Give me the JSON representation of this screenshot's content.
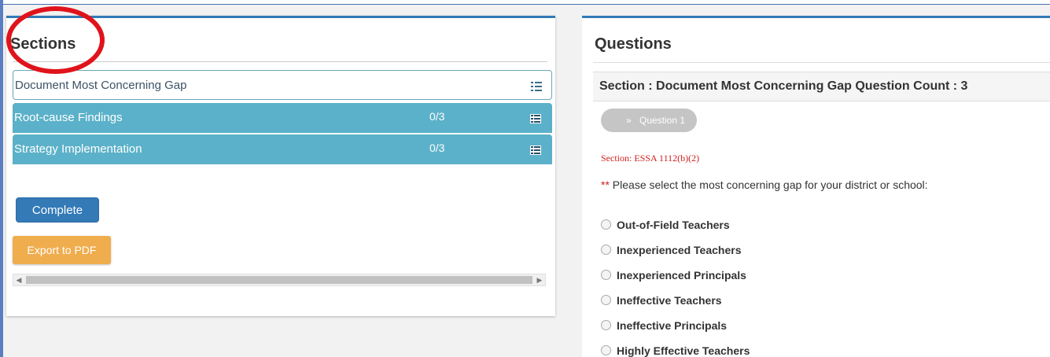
{
  "sections_panel": {
    "title": "Sections",
    "items": [
      {
        "label": "Document Most Concerning Gap",
        "count": "",
        "state": "active"
      },
      {
        "label": "Root-cause Findings",
        "count": "0/3",
        "state": "pending"
      },
      {
        "label": "Strategy Implementation",
        "count": "0/3",
        "state": "pending"
      }
    ],
    "complete_label": "Complete",
    "export_label": "Export to PDF"
  },
  "questions_panel": {
    "title": "Questions",
    "section_header": "Section : Document Most Concerning Gap Question Count : 3",
    "question_tab": "Question 1",
    "source": "Section: ESSA 1112(b)(2)",
    "required_mark": "**",
    "prompt": " Please select the most concerning gap for your district or school:",
    "options": [
      "Out-of-Field Teachers",
      "Inexperienced Teachers",
      "Inexperienced Principals",
      "Ineffective Teachers",
      "Ineffective Principals",
      "Highly Effective Teachers"
    ]
  },
  "colors": {
    "primary": "#337ab7",
    "teal": "#5bb1c9",
    "warning": "#f0ad4e",
    "annotation": "#e0131b"
  }
}
